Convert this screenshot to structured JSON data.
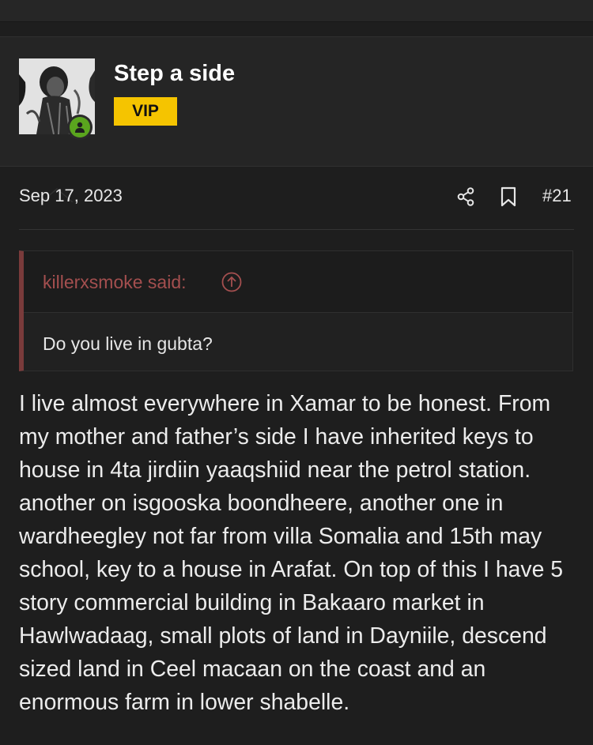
{
  "user": {
    "name": "Step a side",
    "badge": "VIP"
  },
  "post": {
    "date": "Sep 17, 2023",
    "number": "#21",
    "quote": {
      "author": "killerxsmoke said:",
      "text": "Do you live in gubta?"
    },
    "body": "I live almost everywhere in Xamar to be honest. From my mother and father’s side I have inherited keys to house in 4ta jirdiin yaaqshiid near the petrol station. another on isgooska boondheere, another one in wardheegley not far from villa Somalia and 15th may school, key to a house in Arafat. On top of this I have 5 story commercial building in Bakaaro market in Hawlwadaag, small plots of land in Dayniile, descend sized land in Ceel macaan on the coast and an enormous farm in lower shabelle."
  },
  "icons": {
    "online": "person-icon",
    "share": "share-icon",
    "bookmark": "bookmark-icon",
    "quote_jump": "arrow-up-circle-icon"
  },
  "colors": {
    "background": "#1e1e1e",
    "badge": "#f5c400",
    "online": "#5aa51e",
    "quote_accent": "#a44f4f"
  }
}
